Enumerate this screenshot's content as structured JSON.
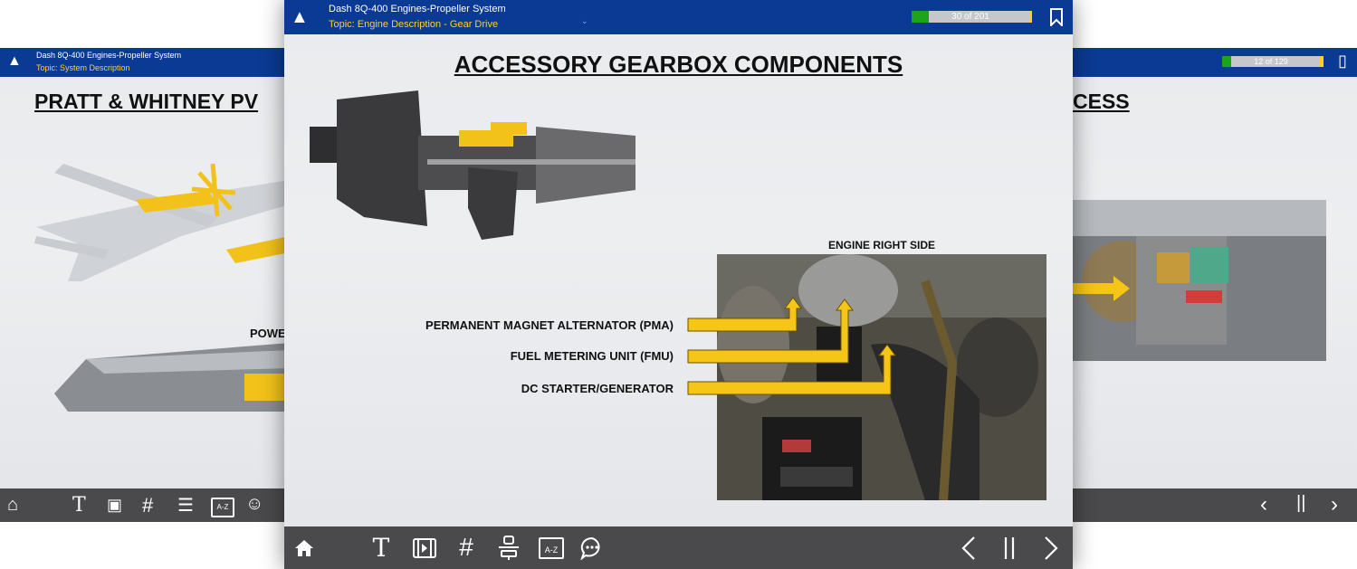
{
  "left_panel": {
    "header": {
      "course": "Dash 8Q-400 Engines-Propeller System",
      "topic": "Topic: System Description"
    },
    "slide_title": "PRATT & WHITNEY PV",
    "label": "POWE"
  },
  "right_panel": {
    "progress": {
      "text": "12 of 129",
      "fraction": 0.093
    },
    "slide_title": "CESS"
  },
  "center_panel": {
    "header": {
      "course": "Dash 8Q-400 Engines-Propeller System",
      "topic": "Topic: Engine Description - Gear Drive"
    },
    "progress": {
      "text": "30 of 201",
      "fraction": 0.149
    },
    "slide_title": "ACCESSORY GEARBOX COMPONENTS",
    "photo_caption": "ENGINE RIGHT SIDE",
    "callouts": [
      "PERMANENT MAGNET ALTERNATOR (PMA)",
      "FUEL METERING UNIT (FMU)",
      "DC STARTER/GENERATOR"
    ]
  },
  "colors": {
    "header_blue": "#0b3a94",
    "topic_yellow": "#ffd21f",
    "progress_green": "#1aa51a",
    "footer_gray": "#4a4a4c",
    "arrow_yellow": "#f5c518"
  },
  "icons": {
    "toolbar": [
      "home-icon",
      "text-icon",
      "video-icon",
      "hash-icon",
      "presenter-icon",
      "glossary-icon",
      "chat-icon"
    ],
    "glossary_label": "A-Z",
    "navigation": [
      "chevron-left-icon",
      "pause-icon",
      "chevron-right-icon"
    ]
  }
}
